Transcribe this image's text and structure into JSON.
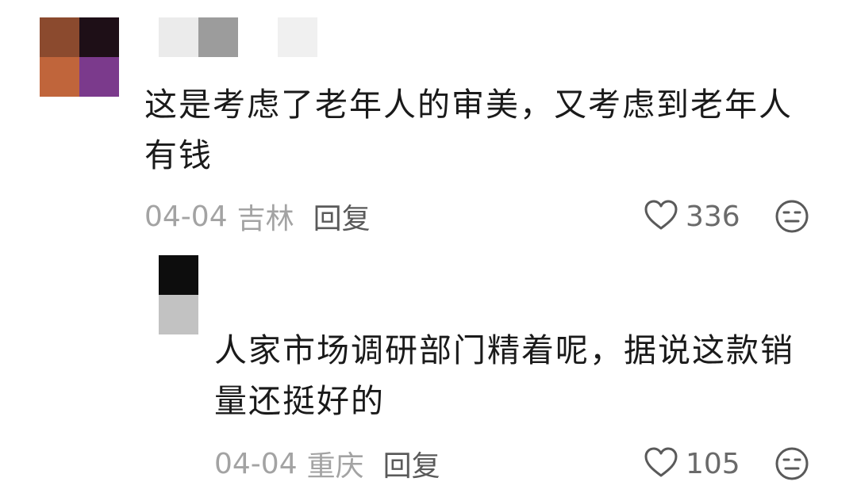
{
  "comments": [
    {
      "text": "这是考虑了老年人的审美，又考虑到老年人\n有钱",
      "date": "04-04",
      "location": "吉林",
      "reply_label": "回复",
      "likes": "336"
    },
    {
      "text": "人家市场调研部门精着呢，据说这款销\n量还挺好的",
      "date": "04-04",
      "location": "重庆",
      "reply_label": "回复",
      "likes": "105"
    }
  ],
  "icons": {
    "like": "heart-outline-icon",
    "reaction": "expressionless-face-icon"
  },
  "colors": {
    "text": "#1a1a1a",
    "meta": "#a3a3a3",
    "reply": "#5a5a5a"
  }
}
